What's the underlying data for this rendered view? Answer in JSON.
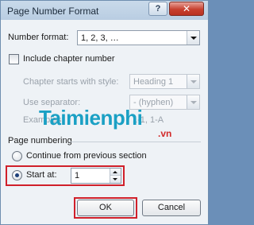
{
  "window": {
    "title": "Page Number Format",
    "help_glyph": "?",
    "close_glyph": "✕"
  },
  "number_format": {
    "label": "Number format:",
    "value": "1, 2, 3, …"
  },
  "include_chapter": {
    "label": "Include chapter number",
    "checked": false
  },
  "chapter_style": {
    "label": "Chapter starts with style:",
    "value": "Heading 1"
  },
  "separator": {
    "label": "Use separator:",
    "value": "- (hyphen)"
  },
  "examples": {
    "label": "Examples:",
    "value": "1-1, 1-A"
  },
  "page_numbering": {
    "heading": "Page numbering",
    "continue_label": "Continue from previous section",
    "start_label": "Start at:",
    "start_value": "1",
    "selected": "start_at"
  },
  "buttons": {
    "ok": "OK",
    "cancel": "Cancel"
  },
  "watermark": {
    "brand": "Taimienphi",
    "suffix": ".vn"
  },
  "colors": {
    "highlight": "#d0202a",
    "accent": "#1c3f7a"
  }
}
